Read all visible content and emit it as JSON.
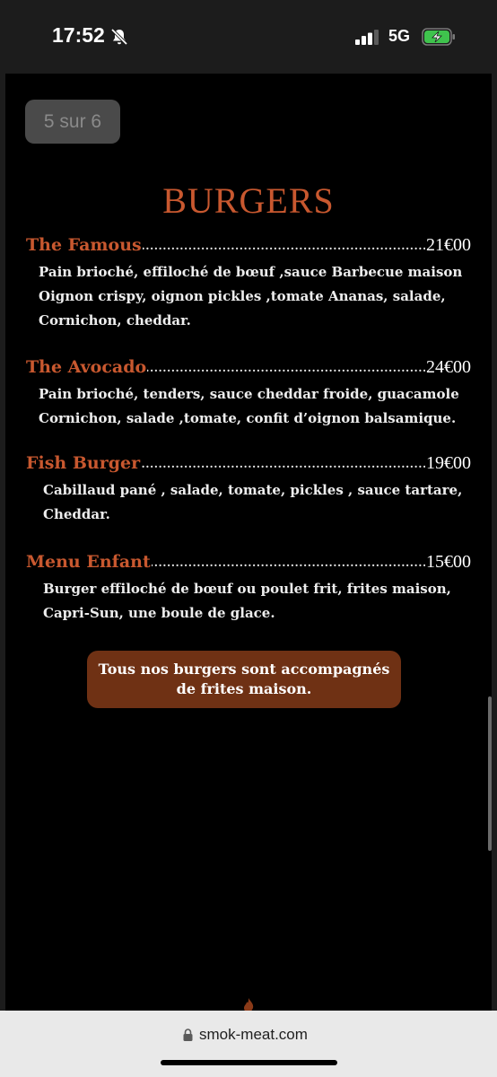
{
  "status_bar": {
    "time": "17:52",
    "network": "5G",
    "icons": [
      "bell-slash-icon",
      "signal-bars-icon",
      "battery-charging-icon"
    ],
    "battery_color": "#3fc34d"
  },
  "page": {
    "page_counter": "5 sur 6",
    "section_title": "BURGERS",
    "items": [
      {
        "name": "The Famous",
        "price": "21€00",
        "description": [
          "Pain brioché, effiloché de bœuf ,sauce Barbecue maison",
          "Oignon crispy, oignon pickles ,tomate Ananas, salade,",
          "Cornichon, cheddar."
        ]
      },
      {
        "name": "The Avocado",
        "price": "24€00",
        "description": [
          "Pain brioché, tenders, sauce cheddar froide, guacamole",
          "Cornichon, salade ,tomate, confit d’oignon balsamique."
        ]
      },
      {
        "name": "Fish Burger",
        "price": "19€00",
        "description": [
          "Cabillaud pané , salade, tomate, pickles , sauce tartare,",
          "Cheddar."
        ]
      },
      {
        "name": "Menu Enfant",
        "price": "15€00",
        "description": [
          "Burger effiloché de bœuf ou poulet frit, frites maison,",
          "Capri-Sun, une boule de glace."
        ]
      }
    ],
    "note": "Tous nos burgers sont accompagnés de frites maison.",
    "colors": {
      "accent": "#c8582f",
      "note_background": "#6f3114",
      "background": "#000000"
    }
  },
  "browser": {
    "url": "smok-meat.com"
  }
}
